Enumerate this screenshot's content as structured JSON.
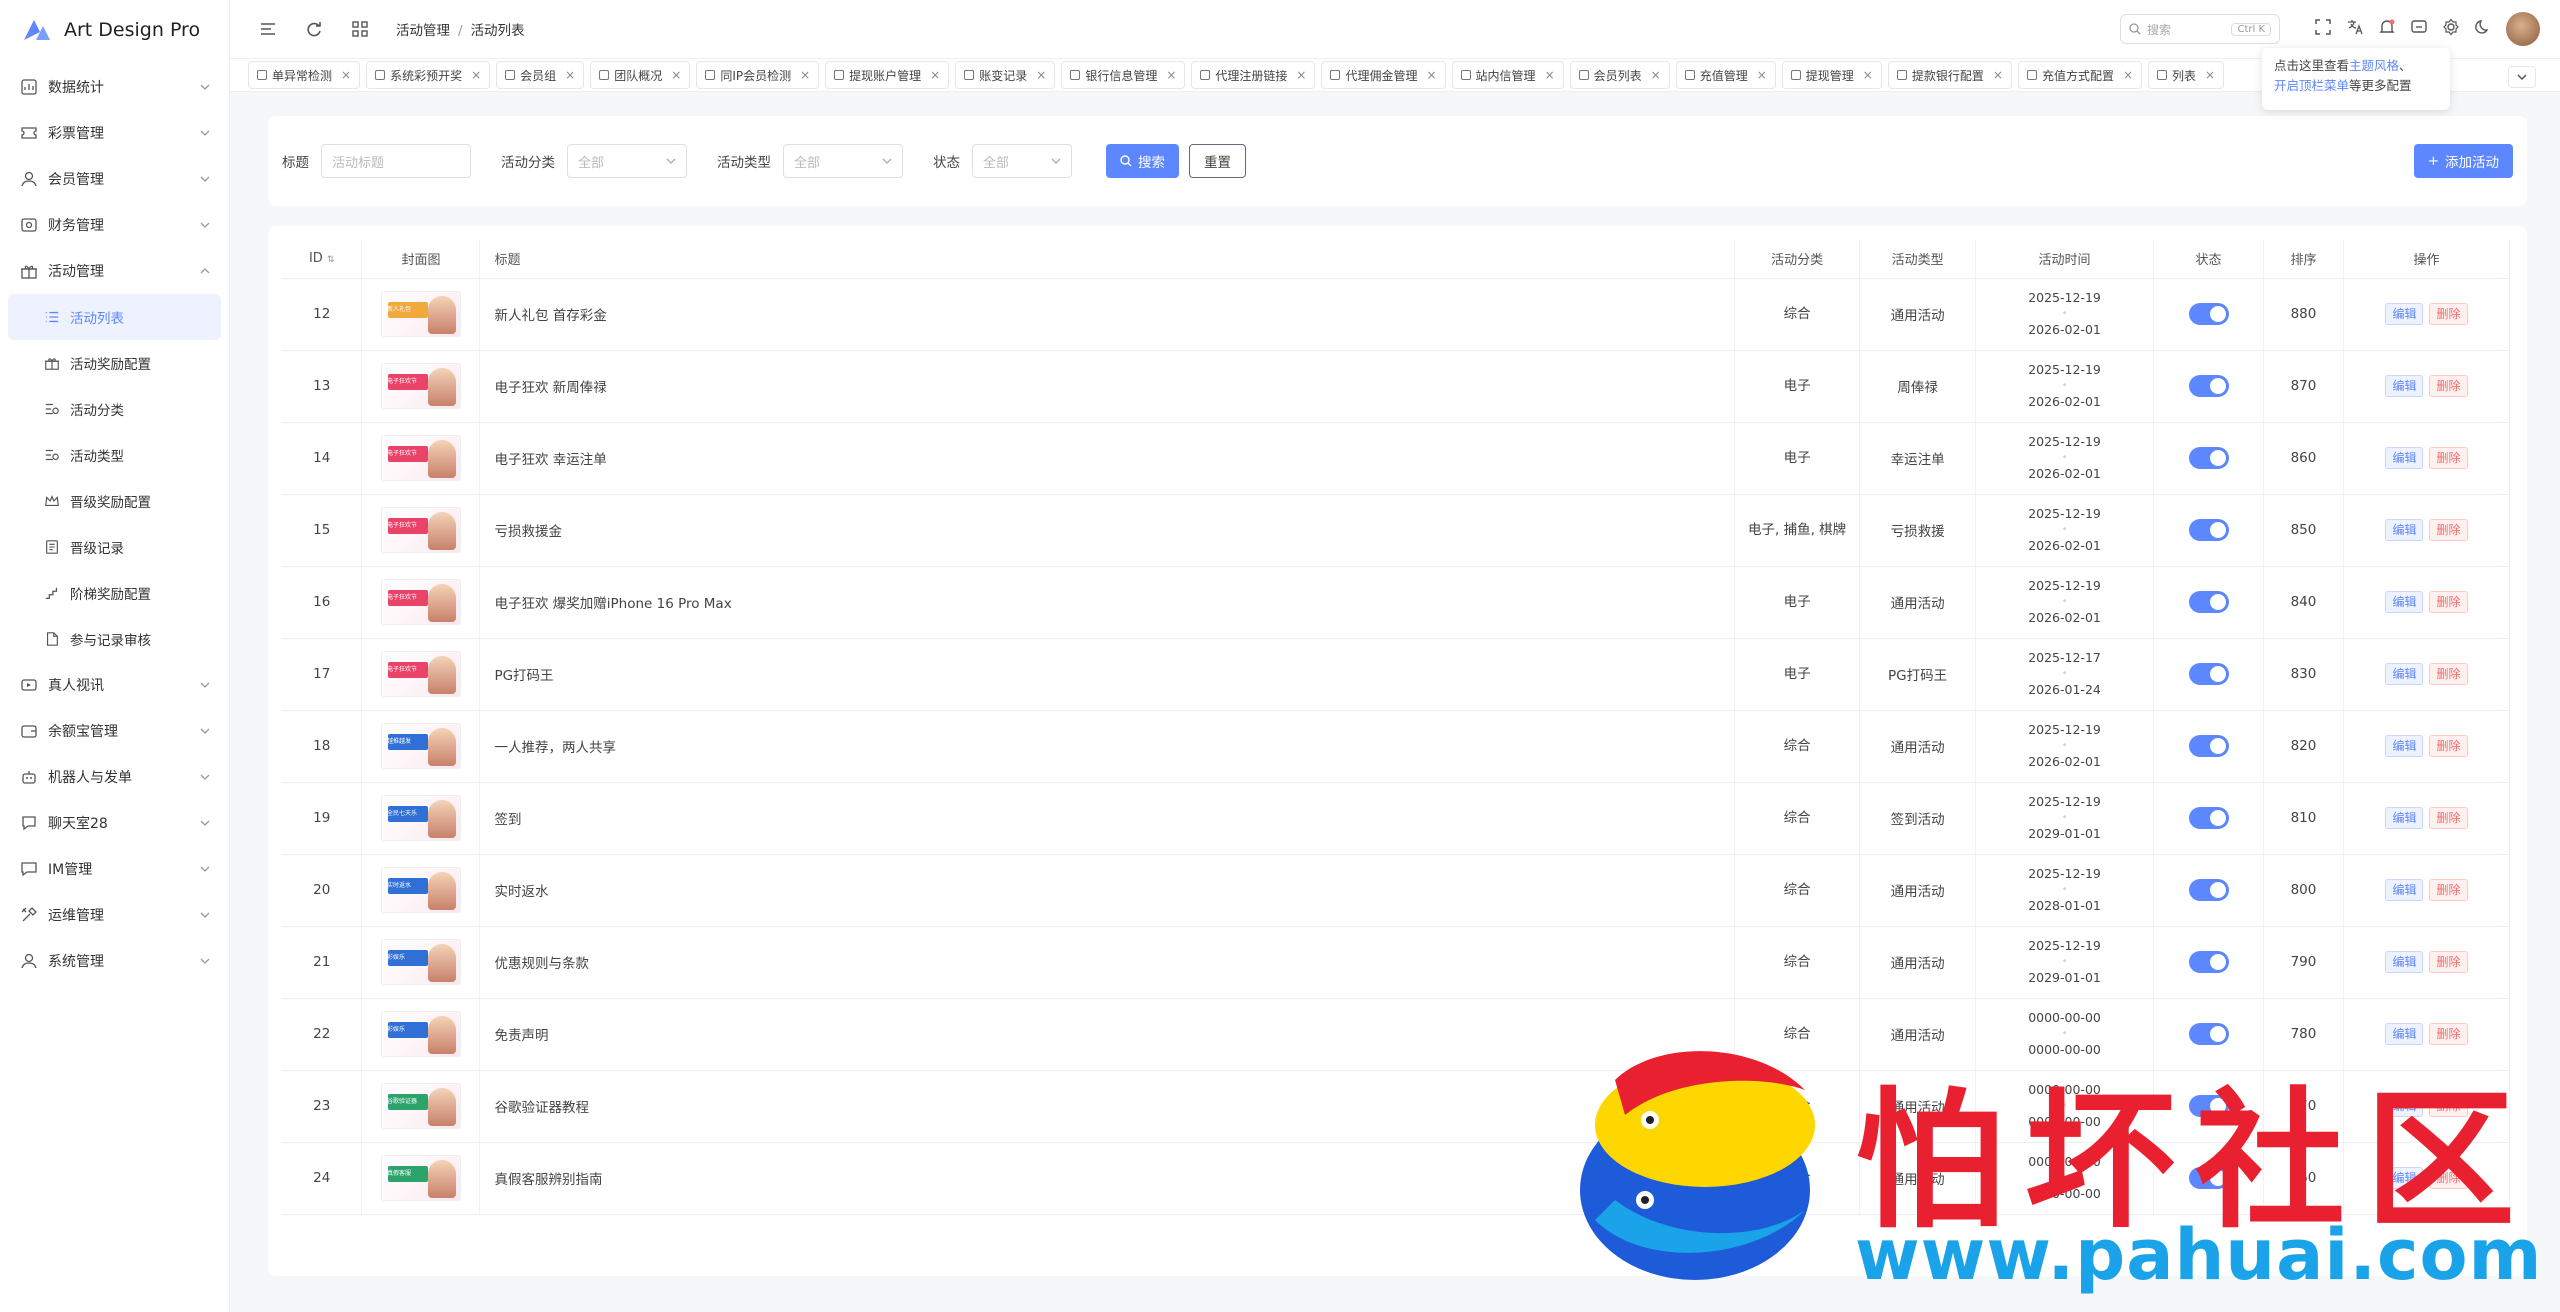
{
  "app": {
    "name": "Art Design Pro"
  },
  "sidebar": {
    "items": [
      {
        "label": "数据统计",
        "icon": "chart-icon"
      },
      {
        "label": "彩票管理",
        "icon": "ticket-icon"
      },
      {
        "label": "会员管理",
        "icon": "user-icon"
      },
      {
        "label": "财务管理",
        "icon": "finance-icon"
      },
      {
        "label": "活动管理",
        "icon": "gift-icon",
        "expanded": true,
        "children": [
          {
            "label": "活动列表",
            "icon": "list-icon",
            "active": true
          },
          {
            "label": "活动奖励配置",
            "icon": "gift-icon"
          },
          {
            "label": "活动分类",
            "icon": "category-icon"
          },
          {
            "label": "活动类型",
            "icon": "category-icon"
          },
          {
            "label": "晋级奖励配置",
            "icon": "crown-icon"
          },
          {
            "label": "晋级记录",
            "icon": "document-icon"
          },
          {
            "label": "阶梯奖励配置",
            "icon": "ladder-icon"
          },
          {
            "label": "参与记录审核",
            "icon": "file-icon"
          }
        ]
      },
      {
        "label": "真人视讯",
        "icon": "video-icon"
      },
      {
        "label": "余额宝管理",
        "icon": "wallet-icon"
      },
      {
        "label": "机器人与发单",
        "icon": "robot-icon"
      },
      {
        "label": "聊天室28",
        "icon": "chat-room-icon"
      },
      {
        "label": "IM管理",
        "icon": "message-icon"
      },
      {
        "label": "运维管理",
        "icon": "tools-icon"
      },
      {
        "label": "系统管理",
        "icon": "user-icon"
      }
    ]
  },
  "header": {
    "breadcrumb": [
      "活动管理",
      "活动列表"
    ],
    "search_placeholder": "搜索",
    "search_kbd": "Ctrl K"
  },
  "tabs": [
    "单异常检测",
    "系统彩预开奖",
    "会员组",
    "团队概况",
    "同IP会员检测",
    "提现账户管理",
    "账变记录",
    "银行信息管理",
    "代理注册链接",
    "代理佣金管理",
    "站内信管理",
    "会员列表",
    "充值管理",
    "提现管理",
    "提款银行配置",
    "充值方式配置",
    "列表"
  ],
  "tip": {
    "line1_a": "点击这里查看",
    "line1_b": "主题风格",
    "line1_c": "、",
    "line2_a": "开启顶栏菜单",
    "line2_b": "等更多配置"
  },
  "filter": {
    "title_label": "标题",
    "title_placeholder": "活动标题",
    "category_label": "活动分类",
    "category_value": "全部",
    "type_label": "活动类型",
    "type_value": "全部",
    "status_label": "状态",
    "status_value": "全部",
    "search_btn": "搜索",
    "reset_btn": "重置",
    "add_btn": "添加活动"
  },
  "table": {
    "headers": {
      "id": "ID",
      "cover": "封面图",
      "title": "标题",
      "category": "活动分类",
      "type": "活动类型",
      "time": "活动时间",
      "status": "状态",
      "sort": "排序",
      "ops": "操作"
    },
    "edit_label": "编辑",
    "delete_label": "删除",
    "rows": [
      {
        "id": "12",
        "cover_text": "新人礼包",
        "title": "新人礼包 首存彩金",
        "category": "综合",
        "type": "通用活动",
        "start": "2025-12-19",
        "end": "2026-02-01",
        "status": true,
        "sort": "880",
        "accent": "#f2a93b"
      },
      {
        "id": "13",
        "cover_text": "电子狂欢节",
        "title": "电子狂欢 新周俸禄",
        "category": "电子",
        "type": "周俸禄",
        "start": "2025-12-19",
        "end": "2026-02-01",
        "status": true,
        "sort": "870",
        "accent": "#e9436a"
      },
      {
        "id": "14",
        "cover_text": "电子狂欢节",
        "title": "电子狂欢 幸运注单",
        "category": "电子",
        "type": "幸运注单",
        "start": "2025-12-19",
        "end": "2026-02-01",
        "status": true,
        "sort": "860",
        "accent": "#e9436a"
      },
      {
        "id": "15",
        "cover_text": "电子狂欢节",
        "title": "亏损救援金",
        "category": "电子, 捕鱼, 棋牌",
        "type": "亏损救援",
        "start": "2025-12-19",
        "end": "2026-02-01",
        "status": true,
        "sort": "850",
        "accent": "#e9436a"
      },
      {
        "id": "16",
        "cover_text": "电子狂欢节",
        "title": "电子狂欢 爆奖加赠iPhone 16 Pro Max",
        "category": "电子",
        "type": "通用活动",
        "start": "2025-12-19",
        "end": "2026-02-01",
        "status": true,
        "sort": "840",
        "accent": "#e9436a"
      },
      {
        "id": "17",
        "cover_text": "电子狂欢节",
        "title": "PG打码王",
        "category": "电子",
        "type": "PG打码王",
        "start": "2025-12-17",
        "end": "2026-01-24",
        "status": true,
        "sort": "830",
        "accent": "#e9436a"
      },
      {
        "id": "18",
        "cover_text": "越推越发",
        "title": "一人推荐，两人共享",
        "category": "综合",
        "type": "通用活动",
        "start": "2025-12-19",
        "end": "2026-02-01",
        "status": true,
        "sort": "820",
        "accent": "#2f6fd6"
      },
      {
        "id": "19",
        "cover_text": "全民七天乐",
        "title": "签到",
        "category": "综合",
        "type": "签到活动",
        "start": "2025-12-19",
        "end": "2029-01-01",
        "status": true,
        "sort": "810",
        "accent": "#2f6fd6"
      },
      {
        "id": "20",
        "cover_text": "实时返水",
        "title": "实时返水",
        "category": "综合",
        "type": "通用活动",
        "start": "2025-12-19",
        "end": "2028-01-01",
        "status": true,
        "sort": "800",
        "accent": "#2f6fd6"
      },
      {
        "id": "21",
        "cover_text": "彩娱乐",
        "title": "优惠规则与条款",
        "category": "综合",
        "type": "通用活动",
        "start": "2025-12-19",
        "end": "2029-01-01",
        "status": true,
        "sort": "790",
        "accent": "#2f6fd6"
      },
      {
        "id": "22",
        "cover_text": "彩娱乐",
        "title": "免责声明",
        "category": "综合",
        "type": "通用活动",
        "start": "0000-00-00",
        "end": "0000-00-00",
        "status": true,
        "sort": "780",
        "accent": "#2f6fd6"
      },
      {
        "id": "23",
        "cover_text": "谷歌验证器",
        "title": "谷歌验证器教程",
        "category": "综合",
        "type": "通用活动",
        "start": "0000-00-00",
        "end": "0000-00-00",
        "status": true,
        "sort": "770",
        "accent": "#2ba36b"
      },
      {
        "id": "24",
        "cover_text": "真假客服",
        "title": "真假客服辨别指南",
        "category": "综合",
        "type": "通用活动",
        "start": "0000-00-00",
        "end": "0000-00-00",
        "status": true,
        "sort": "760",
        "accent": "#2ba36b"
      }
    ]
  },
  "watermark": {
    "text": "怕坏社区",
    "url": "www.pahuai.com"
  }
}
